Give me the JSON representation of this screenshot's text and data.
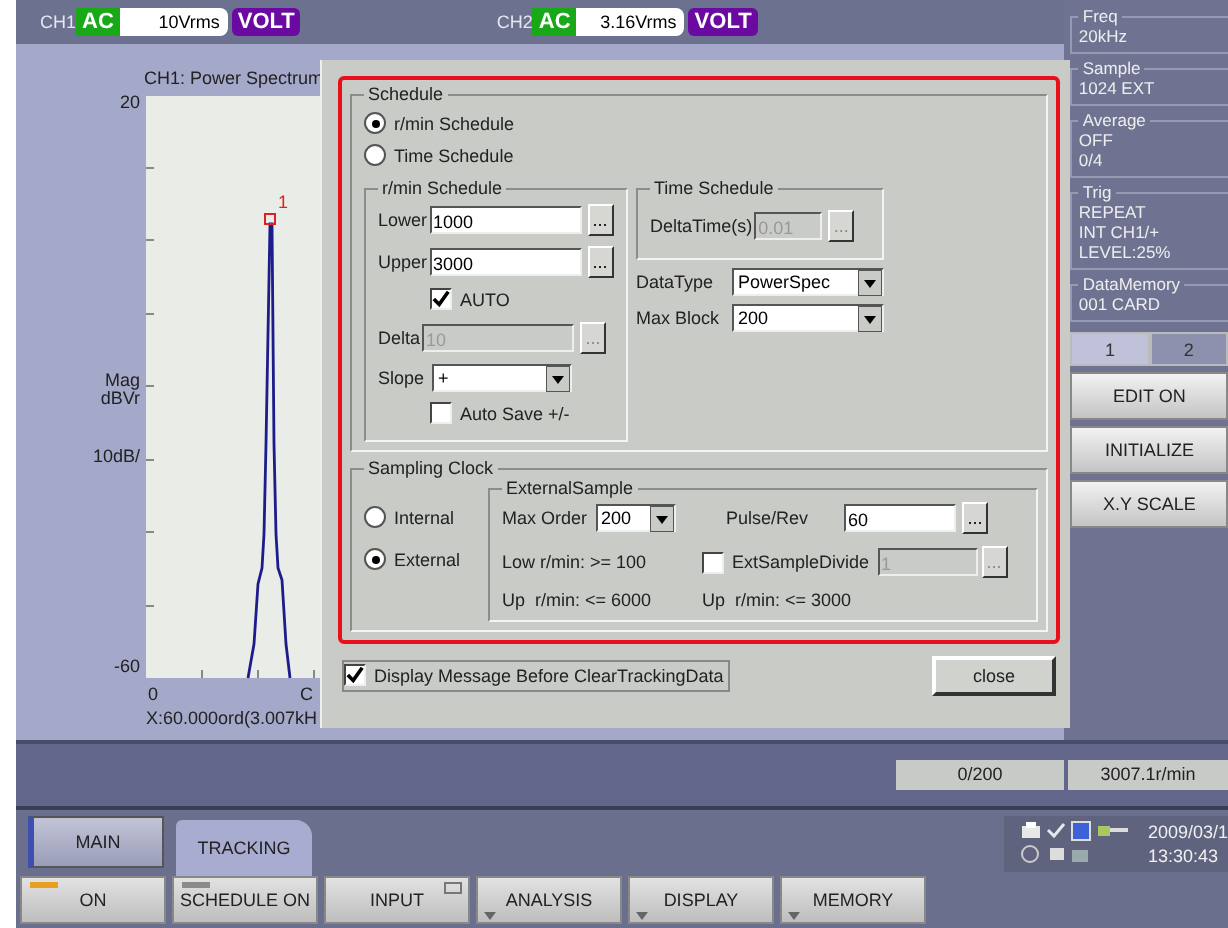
{
  "channels": [
    {
      "label": "CH1",
      "coupling": "AC",
      "range": "10Vrms",
      "unit": "VOLT"
    },
    {
      "label": "CH2",
      "coupling": "AC",
      "range": "3.16Vrms",
      "unit": "VOLT"
    }
  ],
  "chart": {
    "title": "CH1: Power Spectrum",
    "y_max": "20",
    "y_unit": "Mag",
    "y_unit2": "dBVr",
    "y_scale": "10dB/",
    "y_min": "-60",
    "x_min": "0",
    "x_max": "C",
    "marker": "1",
    "cursor": "X:60.000ord(3.007kH"
  },
  "dialog": {
    "schedule": {
      "title": "Schedule",
      "modes": [
        {
          "label": "r/min Schedule",
          "selected": true
        },
        {
          "label": "Time Schedule",
          "selected": false
        }
      ],
      "rpm": {
        "title": "r/min Schedule",
        "lower": {
          "label": "Lower",
          "value": "1000",
          "button": "...",
          "disabled": false
        },
        "upper": {
          "label": "Upper",
          "value": "3000",
          "button": "...",
          "disabled": false
        },
        "auto": {
          "label": "AUTO",
          "checked": true
        },
        "delta": {
          "label": "Delta",
          "value": "10",
          "button": "...",
          "disabled": true
        },
        "slope": {
          "label": "Slope",
          "value": "+"
        },
        "auto_save": {
          "label": "Auto Save +/-",
          "checked": false
        }
      },
      "time": {
        "title": "Time Schedule",
        "delta_time": {
          "label": "DeltaTime(s)",
          "value": "0.01",
          "button": "...",
          "disabled": true
        }
      },
      "data_type": {
        "label": "DataType",
        "value": "PowerSpec"
      },
      "max_block": {
        "label": "Max Block",
        "value": "200"
      }
    },
    "sampling": {
      "title": "Sampling Clock",
      "modes": [
        {
          "label": "Internal",
          "selected": false
        },
        {
          "label": "External",
          "selected": true
        }
      ],
      "external": {
        "title": "ExternalSample",
        "max_order": {
          "label": "Max Order",
          "value": "200"
        },
        "pulse_rev": {
          "label": "Pulse/Rev",
          "value": "60",
          "button": "...",
          "disabled": false
        },
        "low_rpm": "Low r/min: >= 100",
        "ext_divide": {
          "label": "ExtSampleDivide",
          "checked": false,
          "value": "1",
          "button": "...",
          "disabled": true
        },
        "up_rpm": "Up  r/min: <= 6000",
        "up_rpm2": "Up  r/min: <= 3000"
      }
    },
    "display_message": {
      "label": "Display Message Before ClearTrackingData",
      "checked": true
    },
    "close": "close"
  },
  "side_panel": {
    "sections": [
      {
        "title": "Freq",
        "lines": [
          "20kHz"
        ]
      },
      {
        "title": "Sample",
        "lines": [
          "1024 EXT"
        ]
      },
      {
        "title": "Average",
        "lines": [
          "OFF",
          "0/4"
        ]
      },
      {
        "title": "Trig",
        "lines": [
          "REPEAT",
          "INT CH1/+",
          "LEVEL:25%"
        ]
      },
      {
        "title": "DataMemory",
        "lines": [
          "001  CARD"
        ]
      }
    ],
    "page_tabs": [
      {
        "label": "1",
        "selected": true
      },
      {
        "label": "2",
        "selected": false
      }
    ],
    "buttons": [
      "EDIT ON",
      "INITIALIZE",
      "X.Y SCALE"
    ]
  },
  "status": {
    "blocks": "0/200",
    "speed": "3007.1r/min"
  },
  "tabs": [
    {
      "label": "MAIN",
      "selected": false
    },
    {
      "label": "TRACKING",
      "selected": true
    }
  ],
  "clock": {
    "date": "2009/03/1",
    "time": "13:30:43"
  },
  "function_keys": [
    {
      "label": "ON",
      "kind": "toggle",
      "on": true
    },
    {
      "label": "SCHEDULE ON",
      "kind": "toggle",
      "on": false
    },
    {
      "label": "INPUT",
      "kind": "window"
    },
    {
      "label": "ANALYSIS",
      "kind": "menu"
    },
    {
      "label": "DISPLAY",
      "kind": "menu"
    },
    {
      "label": "MEMORY",
      "kind": "menu"
    }
  ]
}
